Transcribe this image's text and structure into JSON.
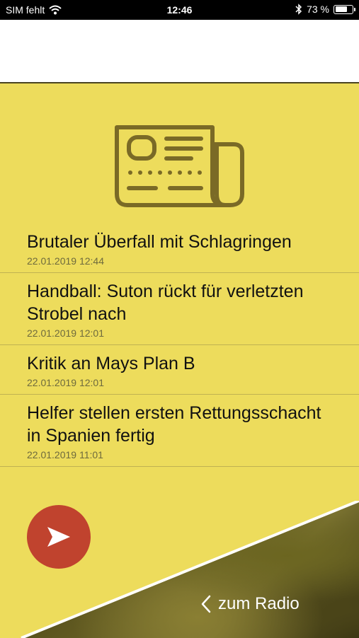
{
  "status_bar": {
    "carrier": "SIM fehlt",
    "time": "12:46",
    "battery_percent_text": "73 %",
    "battery_level": 0.73
  },
  "news": {
    "items": [
      {
        "title": "Brutaler Überfall mit Schlagringen",
        "date": "22.01.2019 12:44"
      },
      {
        "title": "Handball: Suton rückt für verletzten Strobel nach",
        "date": "22.01.2019 12:01"
      },
      {
        "title": "Kritik an Mays Plan B",
        "date": "22.01.2019 12:01"
      },
      {
        "title": "Helfer stellen ersten Rettungsschacht in Spanien fertig",
        "date": "22.01.2019 11:01"
      }
    ]
  },
  "footer": {
    "radio_link_label": "zum Radio"
  },
  "colors": {
    "background_yellow": "#eddc5c",
    "icon_olive": "#7a6a26",
    "play_button_red": "#c0432e"
  },
  "icons": {
    "news": "newspaper-icon",
    "play": "play-icon",
    "back": "chevron-left-icon",
    "wifi": "wifi-icon",
    "bluetooth": "bluetooth-icon",
    "battery": "battery-icon"
  }
}
